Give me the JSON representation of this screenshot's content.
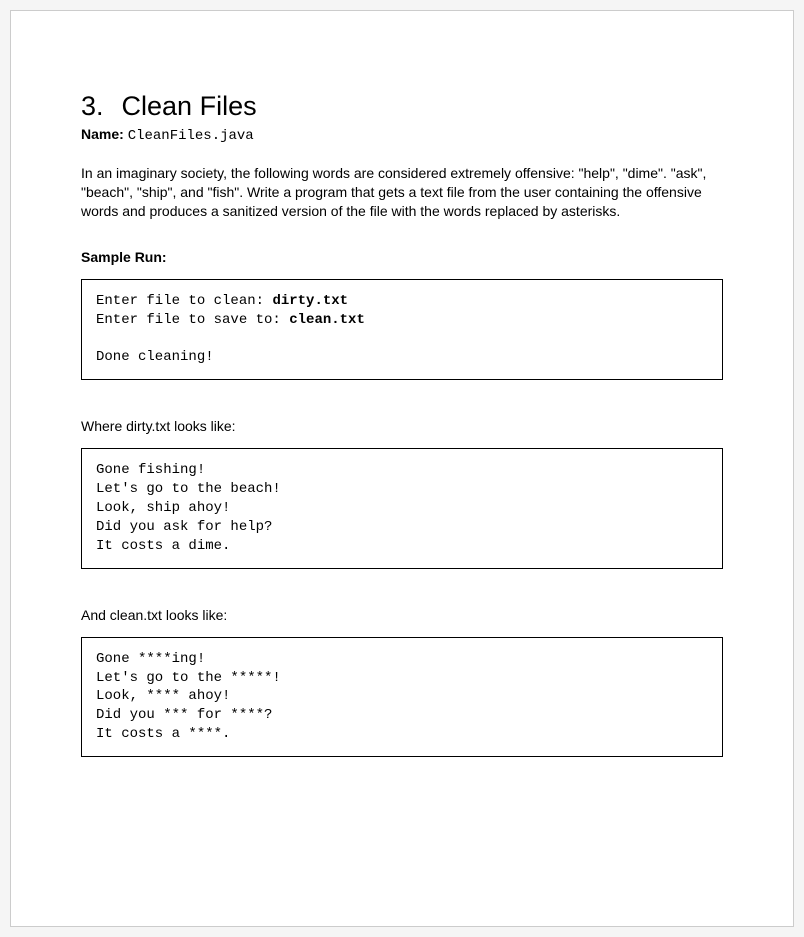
{
  "title": {
    "number": "3.",
    "text": "Clean Files"
  },
  "name": {
    "label": "Name:",
    "value": "CleanFiles.java"
  },
  "description": "In an imaginary society, the following words are considered extremely offensive: \"help\", \"dime\". \"ask\", \"beach\", \"ship\", and \"fish\". Write a program that gets a text file from the user containing the offensive words and produces a sanitized version of the file with the words replaced by asterisks.",
  "sample_run": {
    "label": "Sample Run:",
    "line1_prompt": "Enter file to clean: ",
    "line1_input": "dirty.txt",
    "line2_prompt": "Enter file to save to: ",
    "line2_input": "clean.txt",
    "line3": "Done cleaning!"
  },
  "dirty": {
    "label": "Where dirty.txt looks like:",
    "content": "Gone fishing!\nLet's go to the beach!\nLook, ship ahoy!\nDid you ask for help?\nIt costs a dime."
  },
  "clean": {
    "label": "And clean.txt looks like:",
    "content": "Gone ****ing!\nLet's go to the *****!\nLook, **** ahoy!\nDid you *** for ****?\nIt costs a ****."
  }
}
